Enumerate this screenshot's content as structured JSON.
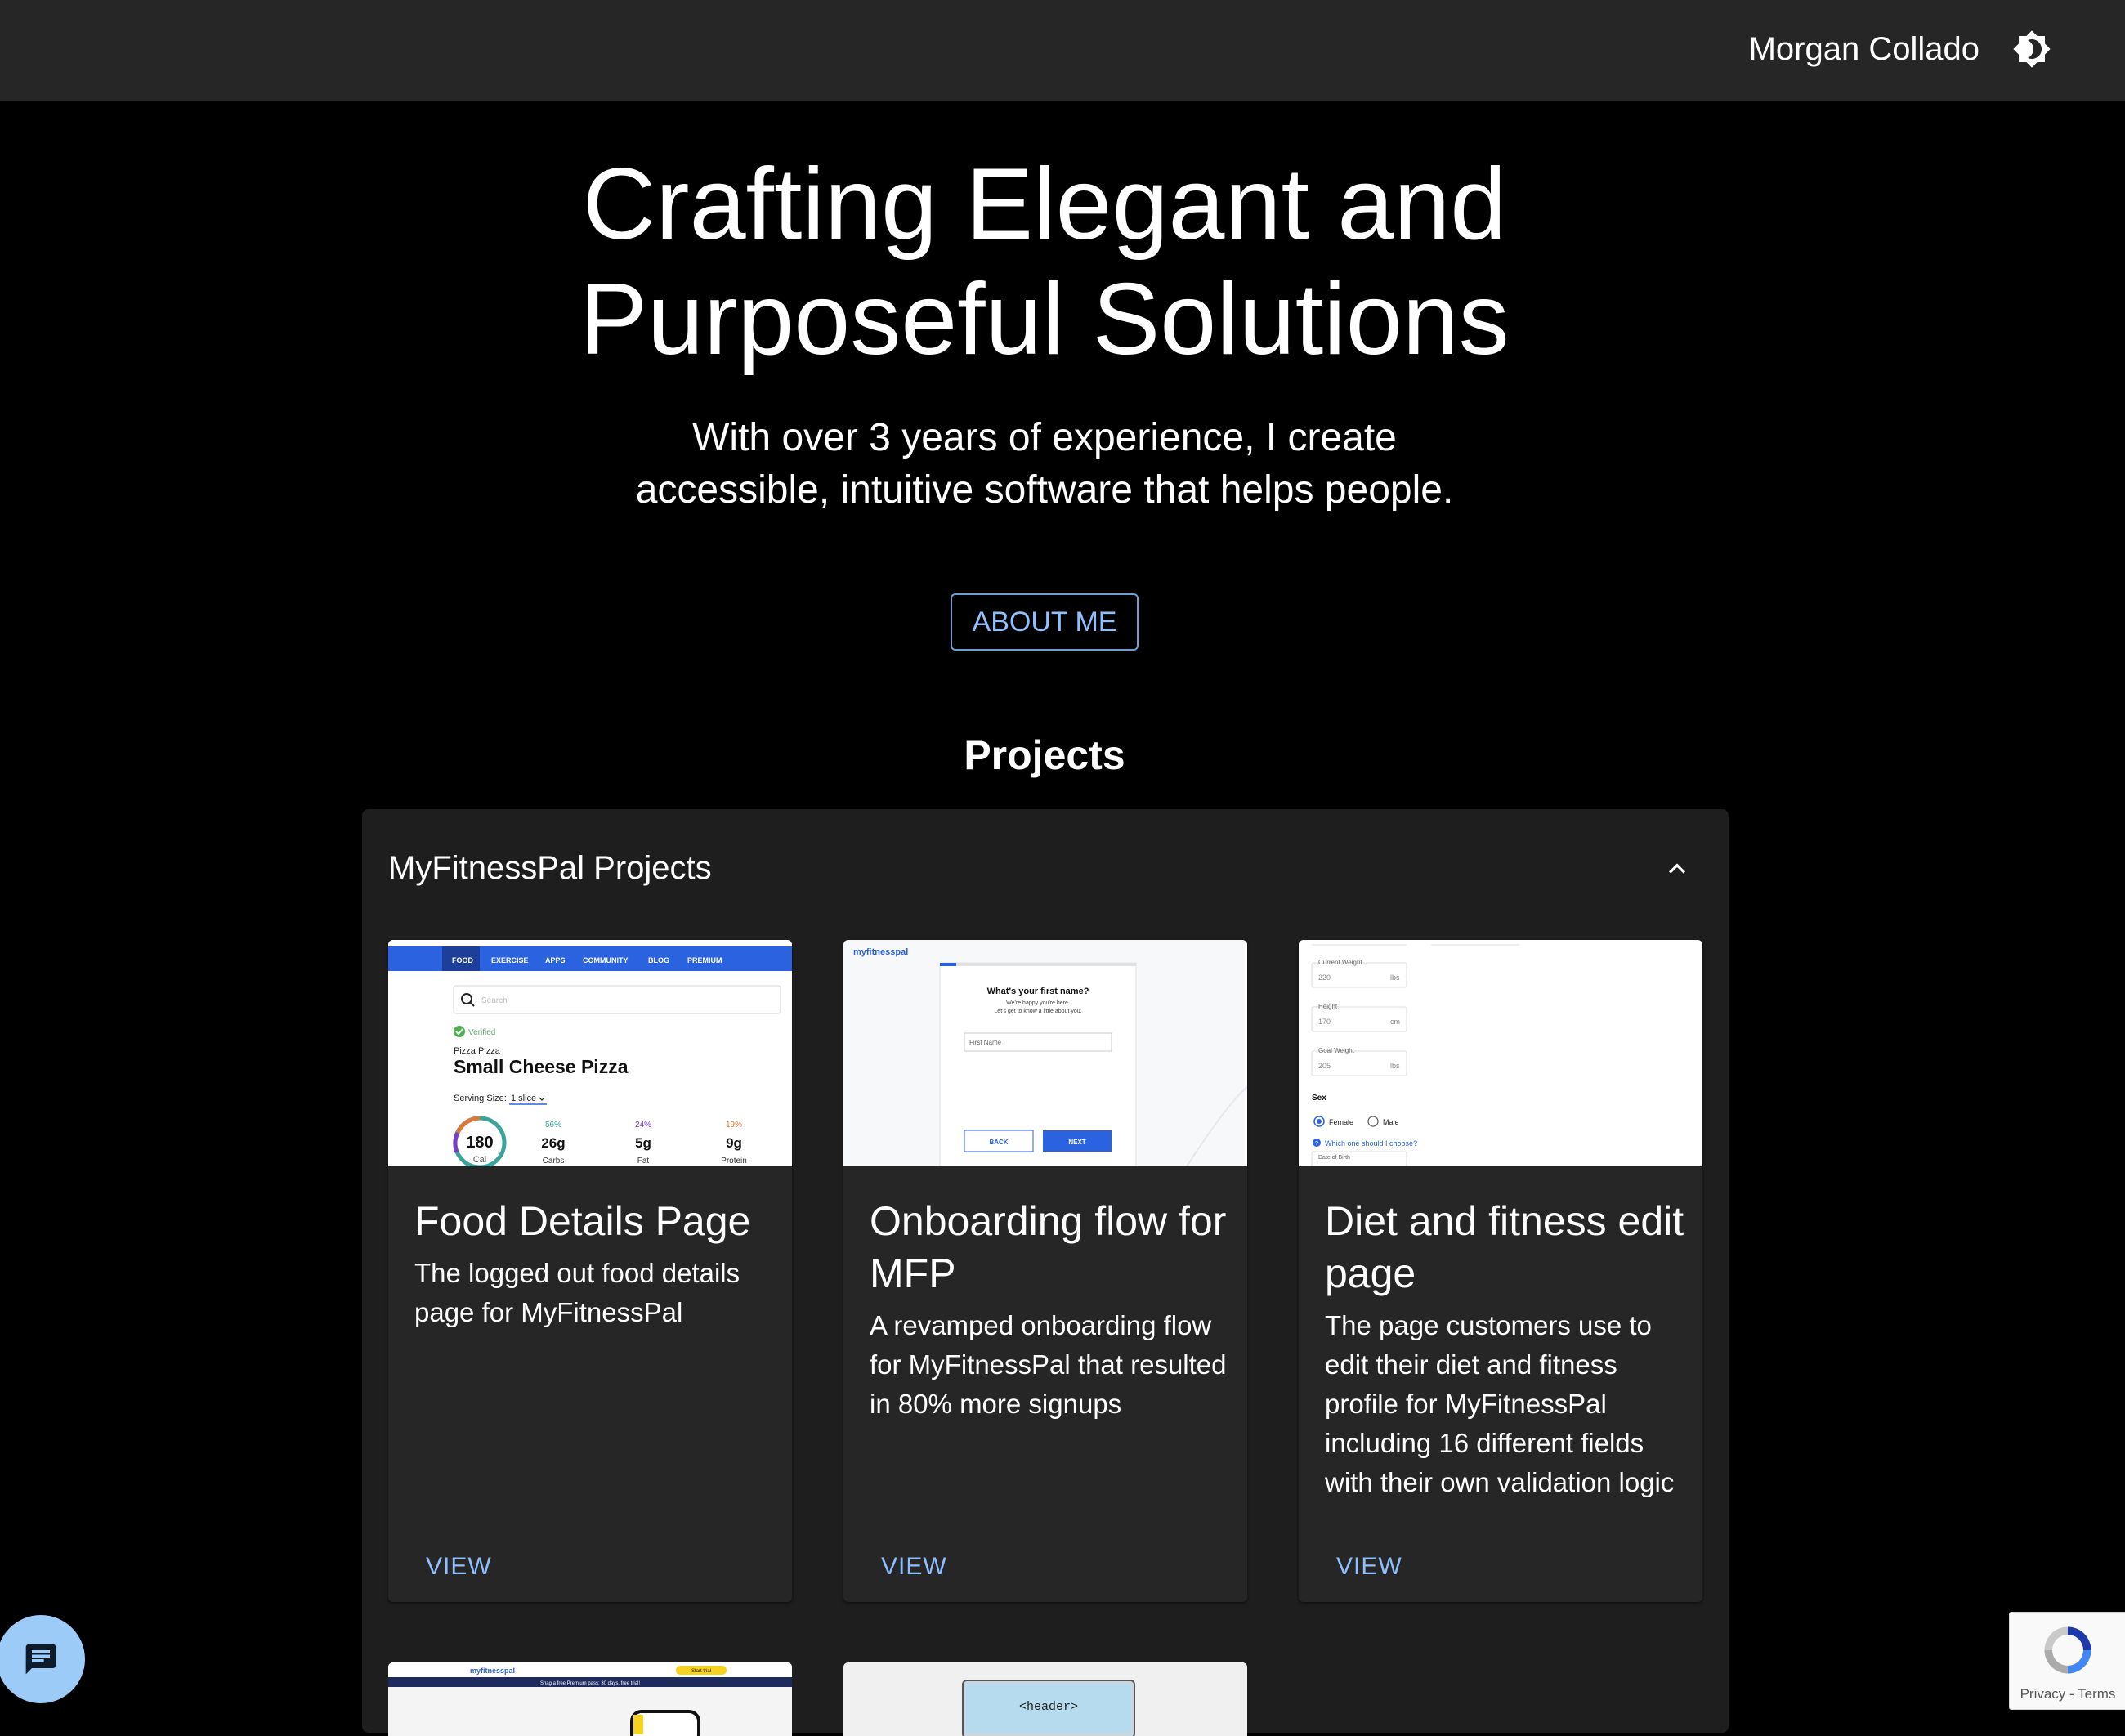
{
  "header": {
    "site_name": "Morgan Collado",
    "theme_toggle_icon": "brightness-icon"
  },
  "hero": {
    "title": "Crafting Elegant and Purposeful Solutions",
    "subtitle": "With over 3 years of experience, I create accessible, intuitive software that helps people.",
    "button_label": "ABOUT ME"
  },
  "projects": {
    "heading": "Projects",
    "group_title": "MyFitnessPal Projects",
    "toggle_icon": "chevron-up-icon",
    "cards": [
      {
        "title": "Food Details Page",
        "description": "The logged out food details page for MyFitnessPal",
        "action": "VIEW",
        "preview": {
          "nav": [
            "FOOD",
            "EXERCISE",
            "APPS",
            "COMMUNITY",
            "BLOG",
            "PREMIUM"
          ],
          "search_placeholder": "Search",
          "verified": "Verified",
          "brand": "Pizza Pizza",
          "food_name": "Small Cheese Pizza",
          "serving_label": "Serving Size:",
          "serving_value": "1 slice",
          "calories": "180",
          "calories_unit": "Cal",
          "macros": [
            {
              "pct": "56%",
              "amount": "26g",
              "label": "Carbs",
              "color": "#3aa39a"
            },
            {
              "pct": "24%",
              "amount": "5g",
              "label": "Fat",
              "color": "#7b3fc4"
            },
            {
              "pct": "19%",
              "amount": "9g",
              "label": "Protein",
              "color": "#e0773a"
            }
          ]
        }
      },
      {
        "title": "Onboarding flow for MFP",
        "description": "A revamped onboarding flow for MyFitnessPal that resulted in 80% more signups",
        "action": "VIEW",
        "preview": {
          "logo": "myfitnesspal",
          "question": "What's your first name?",
          "line1": "We're happy you're here.",
          "line2": "Let's get to know a little about you.",
          "input_label": "First Name",
          "back": "BACK",
          "next": "NEXT"
        }
      },
      {
        "title": "Diet and fitness edit page",
        "description": "The page customers use to edit their diet and fitness profile for MyFitnessPal including 16 different fields with their own validation logic",
        "action": "VIEW",
        "preview": {
          "fields": [
            {
              "label": "Current Weight",
              "value": "220",
              "unit": "lbs"
            },
            {
              "label": "Height",
              "value": "170",
              "unit": "cm"
            },
            {
              "label": "Goal Weight",
              "value": "205",
              "unit": "lbs"
            }
          ],
          "sex_label": "Sex",
          "female": "Female",
          "male": "Male",
          "help_link": "Which one should I choose?",
          "dob_label": "Date of Birth"
        }
      }
    ],
    "partial_cards": [
      {
        "logo": "myfitnesspal",
        "banner": "Snag a free Premium pass: 30 days, free trial!",
        "cta": "Start trial"
      },
      {
        "header_tag": "<header>"
      }
    ]
  },
  "chat": {
    "icon": "chat-icon"
  },
  "recaptcha": {
    "privacy": "Privacy",
    "separator": " - ",
    "terms": "Terms"
  },
  "colors": {
    "background": "#000000",
    "appbar": "#262626",
    "panel": "#1e1e1e",
    "card": "#262626",
    "accent": "#8ec0ff",
    "mfp_blue": "#2b62e0"
  }
}
